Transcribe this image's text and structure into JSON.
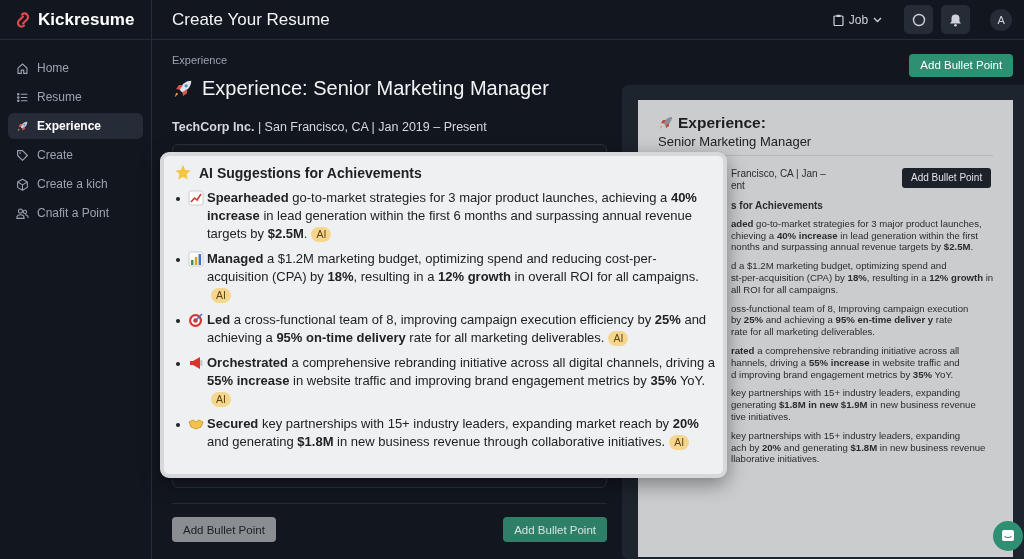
{
  "brand": {
    "name": "Kickresume"
  },
  "header": {
    "title": "Create Your Resume",
    "job_menu": "Job",
    "avatar": "A"
  },
  "sidebar": {
    "items": [
      {
        "label": "Home",
        "selected": false
      },
      {
        "label": "Resume",
        "selected": false
      },
      {
        "label": "Experience",
        "selected": true
      },
      {
        "label": "Create",
        "selected": false
      },
      {
        "label": "Create a kich",
        "selected": false
      },
      {
        "label": "Cnafit a Point",
        "selected": false
      }
    ]
  },
  "editor": {
    "section_label": "Experience",
    "title": "Experience: Senior Marketing Manager",
    "company_line": "**TechCorp Inc.** | San Francisco, CA | Jan 2019 – Present",
    "buttons": [
      {
        "label": "Add Bullet Point",
        "kind": "secondary"
      },
      {
        "label": "Add Bullet Point",
        "kind": "primary"
      }
    ]
  },
  "top_button": "Add Bullet Point",
  "preview": {
    "heading": "Experience:",
    "subheading": "Senior Marketing Manager",
    "meta_lines": [
      "Francisco, CA | Jan –",
      "ent"
    ],
    "button": "Add Bullet Point",
    "section": "s for Achievements",
    "paragraphs": [
      [
        "**aded** go-to-market strategies for 3 major product launches,",
        "chieving a **40% increase** in lead generation within the first",
        "nonths and surpassing annual revenue targets by **$2.5M**."
      ],
      [
        "d a $1.2M marketing budget, optimizing spend and",
        "st-per-acquisition (CPA) by **18%**, resulting in a **12% growth** in",
        "all ROI for all campaigns."
      ],
      [
        "oss-functional team of 8, Improving campaign execution",
        "by **25%** and achieving a **95% en-time deliver y** rate",
        "rate for all marketing deliverables."
      ],
      [
        "**rated** a comprehensive rebranding initiative across all",
        "hannels, driving a **55% increase** in website traffic and",
        "d improving brand engagement metrics by **35%** YoY."
      ],
      [
        "key partnerships with 15+ industry leaders, expanding",
        "generating **$1.8M in new $1.9M** in new business revenue",
        "tive initiatives."
      ],
      [
        "key partnerships with 15+ industry leaders, expanding",
        "ach by **20%** and generating **$1.8M** in new business revenue",
        "llaborative initiatives."
      ]
    ]
  },
  "suggestions": {
    "title": "AI Suggestions for Achievements",
    "items": [
      {
        "text": "**Spearheaded** go-to-market strategies for 3 major product launches, achieving a **40% increase** in lead generation within the first 6 months and surpassing annual revenue targets by **$2.5M**.",
        "badge": "AI"
      },
      {
        "text": "**Managed** a $1.2M marketing budget, optimizing spend and reducing cost-per-acquisition (CPA) by **18%**, resulting in a **12% growth** in overall ROI for all campaigns.",
        "badge": "AI"
      },
      {
        "text": "**Led** a cross-functional team of 8, improving campaign execution efficiency by **25%** and achieving a **95% on-time delivery** rate for all marketing deliverables.",
        "badge": "AI"
      },
      {
        "text": "**Orchestrated** a comprehensive rebranding initiative across all digital channels, driving a **55% increase** in website traffic and improving brand engagement metrics by **35%** YoY.",
        "badge": "AI"
      },
      {
        "text": "**Secured** key partnerships with 15+ industry leaders, expanding market reach by **20%** and generating **$1.8M** in new business revenue through collaborative initiatives.",
        "badge": "AI"
      }
    ]
  }
}
